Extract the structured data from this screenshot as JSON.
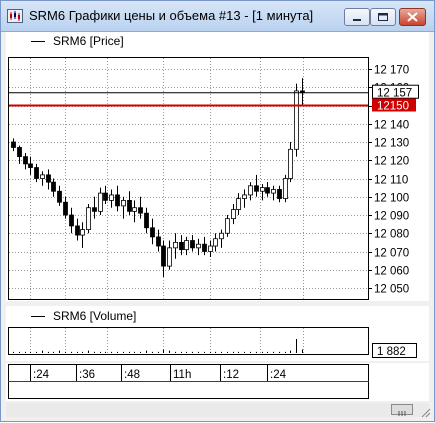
{
  "window": {
    "title": "SRM6 Графики цены и объема #13 - [1 минута]",
    "icons": {
      "app": "chart-app-icon",
      "minimize": "minimize-icon",
      "maximize": "maximize-icon",
      "close": "close-icon"
    }
  },
  "price_panel": {
    "legend": "SRM6 [Price]",
    "y_ticks": [
      "12 170",
      "12 160",
      "12 150",
      "12 140",
      "12 130",
      "12 120",
      "12 110",
      "12 100",
      "12 090",
      "12 080",
      "12 070",
      "12 060",
      "12 050"
    ],
    "last_price_label": "12 157",
    "level_label": "12150",
    "level_color": "#d00000"
  },
  "volume_panel": {
    "legend": "SRM6 [Volume]",
    "last_volume_label": "1 882"
  },
  "time_axis": {
    "labels": [
      ":24",
      ":36",
      ":48",
      "11h",
      ":12",
      ":24"
    ]
  },
  "chart_data": {
    "type": "candlestick",
    "ylim": [
      12045,
      12175
    ],
    "level_line": 12150,
    "candles": [
      [
        12130,
        12132,
        12125,
        12127
      ],
      [
        12127,
        12128,
        12118,
        12122
      ],
      [
        12122,
        12124,
        12115,
        12118
      ],
      [
        12118,
        12122,
        12112,
        12116
      ],
      [
        12116,
        12118,
        12108,
        12110
      ],
      [
        12110,
        12114,
        12106,
        12112
      ],
      [
        12112,
        12115,
        12104,
        12108
      ],
      [
        12108,
        12110,
        12100,
        12103
      ],
      [
        12103,
        12106,
        12095,
        12097
      ],
      [
        12097,
        12100,
        12088,
        12090
      ],
      [
        12090,
        12094,
        12080,
        12084
      ],
      [
        12084,
        12088,
        12076,
        12079
      ],
      [
        12079,
        12086,
        12072,
        12082
      ],
      [
        12082,
        12096,
        12080,
        12094
      ],
      [
        12094,
        12100,
        12088,
        12092
      ],
      [
        12092,
        12105,
        12090,
        12102
      ],
      [
        12102,
        12106,
        12096,
        12098
      ],
      [
        12098,
        12104,
        12094,
        12101
      ],
      [
        12101,
        12106,
        12092,
        12095
      ],
      [
        12095,
        12100,
        12088,
        12098
      ],
      [
        12098,
        12103,
        12090,
        12092
      ],
      [
        12092,
        12098,
        12086,
        12094
      ],
      [
        12094,
        12100,
        12088,
        12091
      ],
      [
        12091,
        12094,
        12080,
        12083
      ],
      [
        12083,
        12088,
        12074,
        12078
      ],
      [
        12078,
        12082,
        12070,
        12073
      ],
      [
        12073,
        12076,
        12056,
        12062
      ],
      [
        12062,
        12076,
        12060,
        12072
      ],
      [
        12072,
        12080,
        12066,
        12075
      ],
      [
        12075,
        12079,
        12068,
        12071
      ],
      [
        12071,
        12078,
        12068,
        12076
      ],
      [
        12076,
        12079,
        12070,
        12072
      ],
      [
        12072,
        12077,
        12068,
        12074
      ],
      [
        12074,
        12078,
        12068,
        12070
      ],
      [
        12070,
        12076,
        12067,
        12073
      ],
      [
        12073,
        12080,
        12070,
        12077
      ],
      [
        12077,
        12082,
        12072,
        12080
      ],
      [
        12080,
        12090,
        12078,
        12088
      ],
      [
        12088,
        12096,
        12085,
        12093
      ],
      [
        12093,
        12102,
        12090,
        12099
      ],
      [
        12099,
        12104,
        12094,
        12101
      ],
      [
        12101,
        12108,
        12098,
        12106
      ],
      [
        12106,
        12112,
        12100,
        12103
      ],
      [
        12103,
        12107,
        12098,
        12105
      ],
      [
        12105,
        12108,
        12100,
        12102
      ],
      [
        12102,
        12106,
        12098,
        12104
      ],
      [
        12104,
        12106,
        12097,
        12099
      ],
      [
        12099,
        12112,
        12097,
        12110
      ],
      [
        12110,
        12130,
        12108,
        12126
      ],
      [
        12126,
        12162,
        12122,
        12158
      ],
      [
        12158,
        12165,
        12150,
        12157
      ]
    ],
    "volume": [
      1,
      1,
      1,
      1,
      1,
      2,
      1,
      1,
      2,
      1,
      1,
      1,
      1,
      2,
      1,
      1,
      1,
      1,
      1,
      1,
      1,
      1,
      1,
      2,
      1,
      1,
      3,
      2,
      1,
      1,
      1,
      1,
      1,
      1,
      1,
      1,
      1,
      1,
      1,
      1,
      1,
      1,
      1,
      1,
      1,
      1,
      1,
      1,
      2,
      12,
      3
    ]
  }
}
